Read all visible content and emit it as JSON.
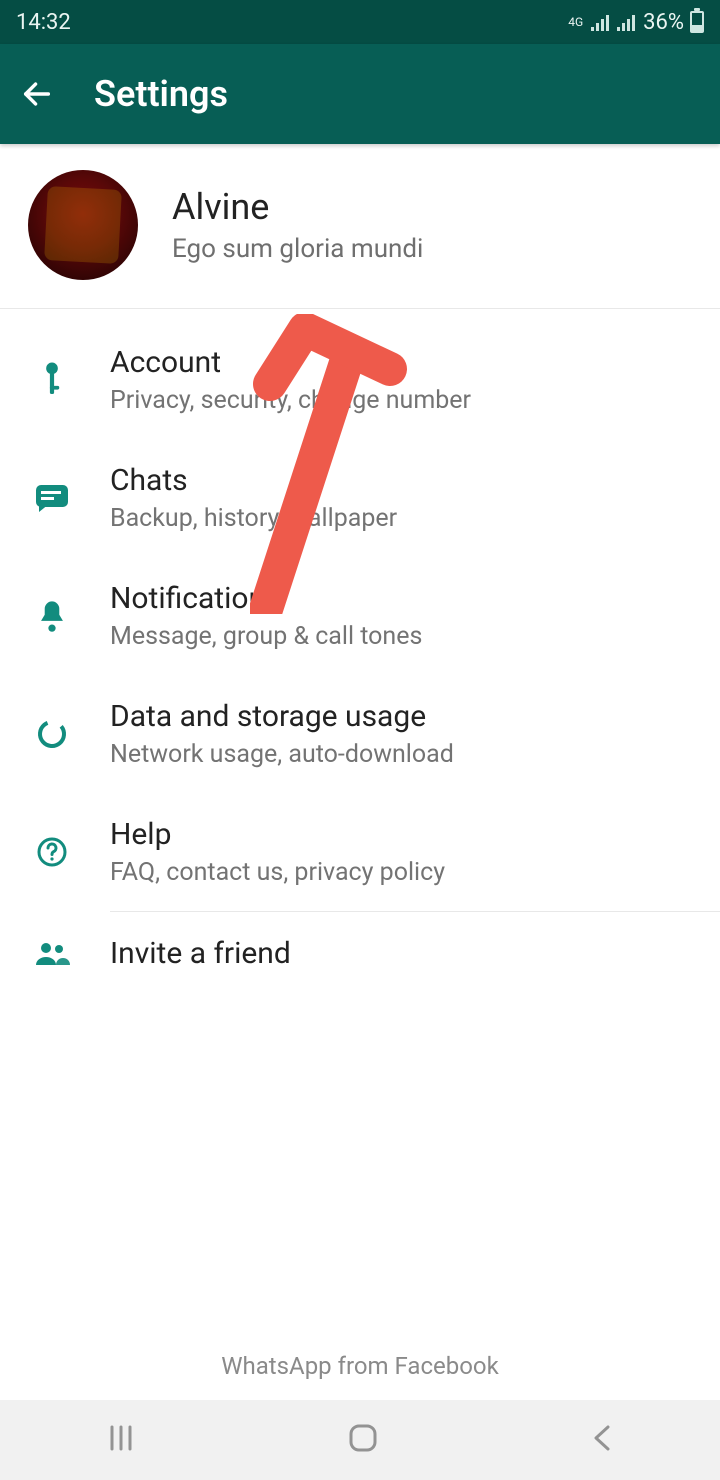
{
  "status": {
    "time": "14:32",
    "network": "4G",
    "battery_pct": "36%"
  },
  "header": {
    "title": "Settings"
  },
  "profile": {
    "name": "Alvine",
    "status": "Ego sum gloria mundi"
  },
  "items": {
    "account": {
      "title": "Account",
      "sub": "Privacy, security, change number"
    },
    "chats": {
      "title": "Chats",
      "sub": "Backup, history, wallpaper"
    },
    "notifications": {
      "title": "Notifications",
      "sub": "Message, group & call tones"
    },
    "data": {
      "title": "Data and storage usage",
      "sub": "Network usage, auto-download"
    },
    "help": {
      "title": "Help",
      "sub": "FAQ, contact us, privacy policy"
    },
    "invite": {
      "title": "Invite a friend"
    }
  },
  "footer": "WhatsApp from Facebook"
}
